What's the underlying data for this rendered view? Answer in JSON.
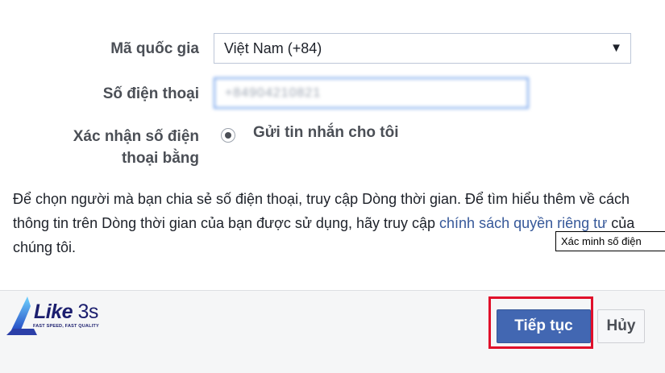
{
  "form": {
    "country_label": "Mã quốc gia",
    "country_value": "Việt Nam (+84)",
    "phone_label": "Số điện thoại",
    "phone_value": "+84904210821",
    "confirm_label_line1": "Xác nhận số điện",
    "confirm_label_line2": "thoại bằng",
    "radio_option": "Gửi tin nhắn cho tôi"
  },
  "info": {
    "text_before_link": "Để chọn người mà bạn chia sẻ số điện thoại, truy cập Dòng thời gian. Để tìm hiểu thêm về cách thông tin trên Dòng thời gian của bạn được sử dụng, hãy truy cập ",
    "link_text": "chính sách quyền riêng tư",
    "text_after_link": " của chúng tôi."
  },
  "tooltip": "Xác minh số điện",
  "logo": {
    "name": "Like",
    "suffix": "3s",
    "tagline": "FAST SPEED, FAST QUALITY"
  },
  "buttons": {
    "continue": "Tiếp tục",
    "cancel": "Hủy"
  },
  "colors": {
    "primary": "#4267b2",
    "highlight": "#e0102a",
    "link": "#365899"
  }
}
